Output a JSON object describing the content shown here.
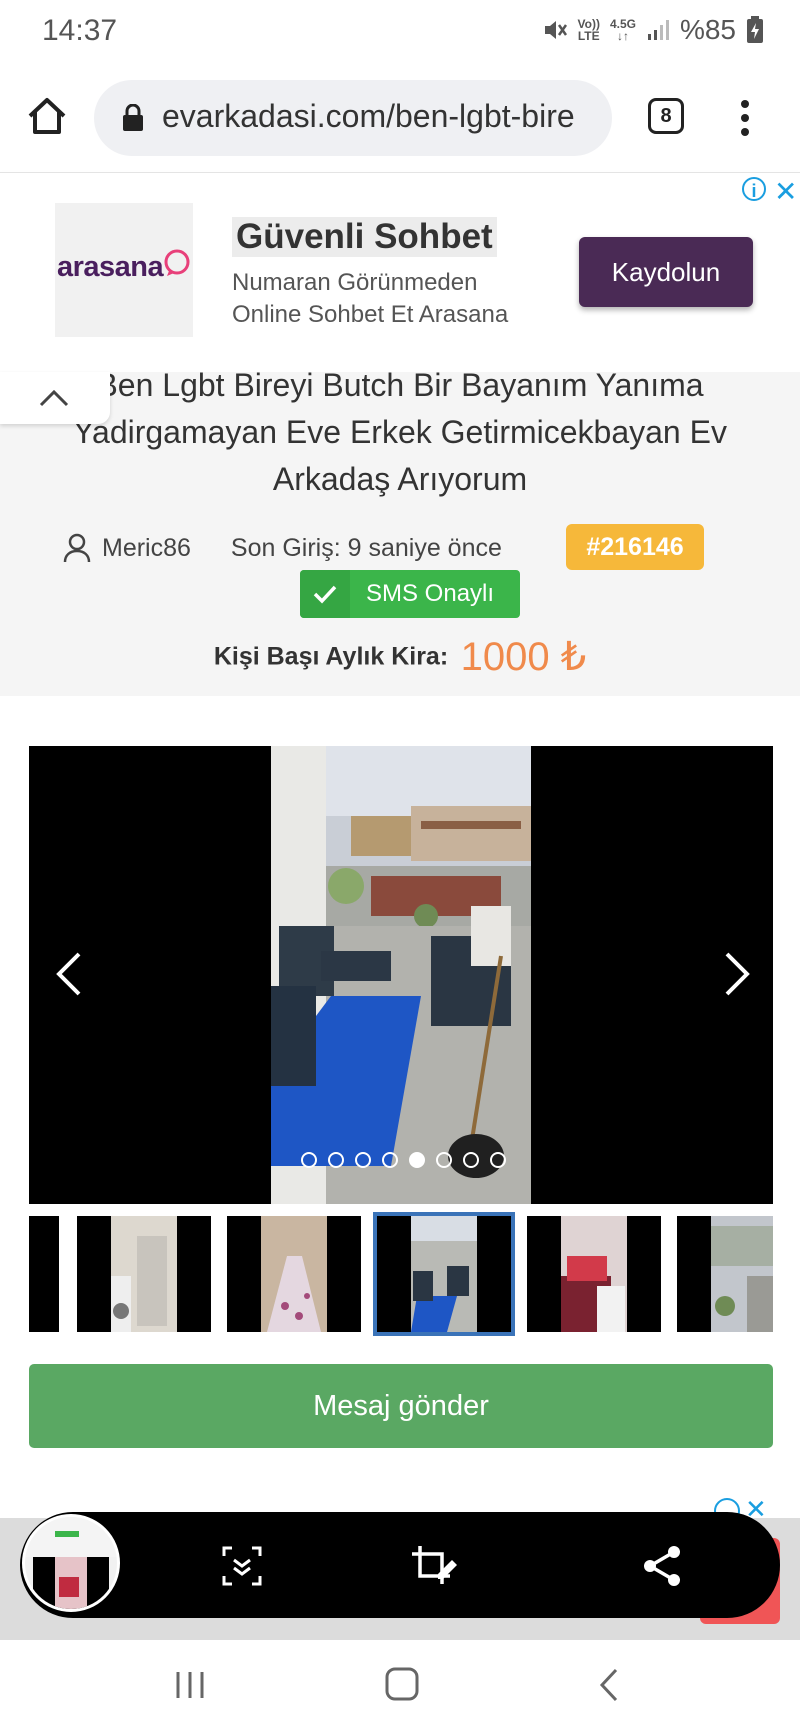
{
  "status_bar": {
    "time": "14:37",
    "battery": "%85",
    "network_top": "4.5G",
    "volte_top": "Vo))",
    "volte_bottom": "LTE"
  },
  "browser": {
    "url": "evarkadasi.com/ben-lgbt-bire",
    "tab_count": "8"
  },
  "ad": {
    "logo_text": "arasana",
    "title": "Güvenli Sohbet",
    "description_line1": "Numaran Görünmeden",
    "description_line2": "Online Sohbet Et Arasana",
    "cta": "Kaydolun"
  },
  "listing": {
    "title_line1": "Ben Lgbt Bireyi Butch Bir Bayanım Yanıma",
    "title_line2": "Yadirgamayan Eve Erkek Getirmicekbayan Ev",
    "title_line3": "Arkadaş Arıyorum",
    "username": "Meric86",
    "last_login": "Son Giriş: 9 saniye önce",
    "listing_id": "#216146",
    "sms_badge": "SMS Onaylı",
    "rent_label": "Kişi Başı Aylık Kira:",
    "rent_value": "1000 ₺"
  },
  "gallery": {
    "photo_count": 8,
    "active_index": 4
  },
  "actions": {
    "send_message": "Mesaj gönder"
  },
  "colors": {
    "accent_green": "#5aa863",
    "sms_green": "#3bb54a",
    "id_badge": "#f6b83a",
    "rent_orange": "#f08a4b",
    "ad_purple": "#4a2a55",
    "thumb_highlight": "#3a73b8"
  }
}
